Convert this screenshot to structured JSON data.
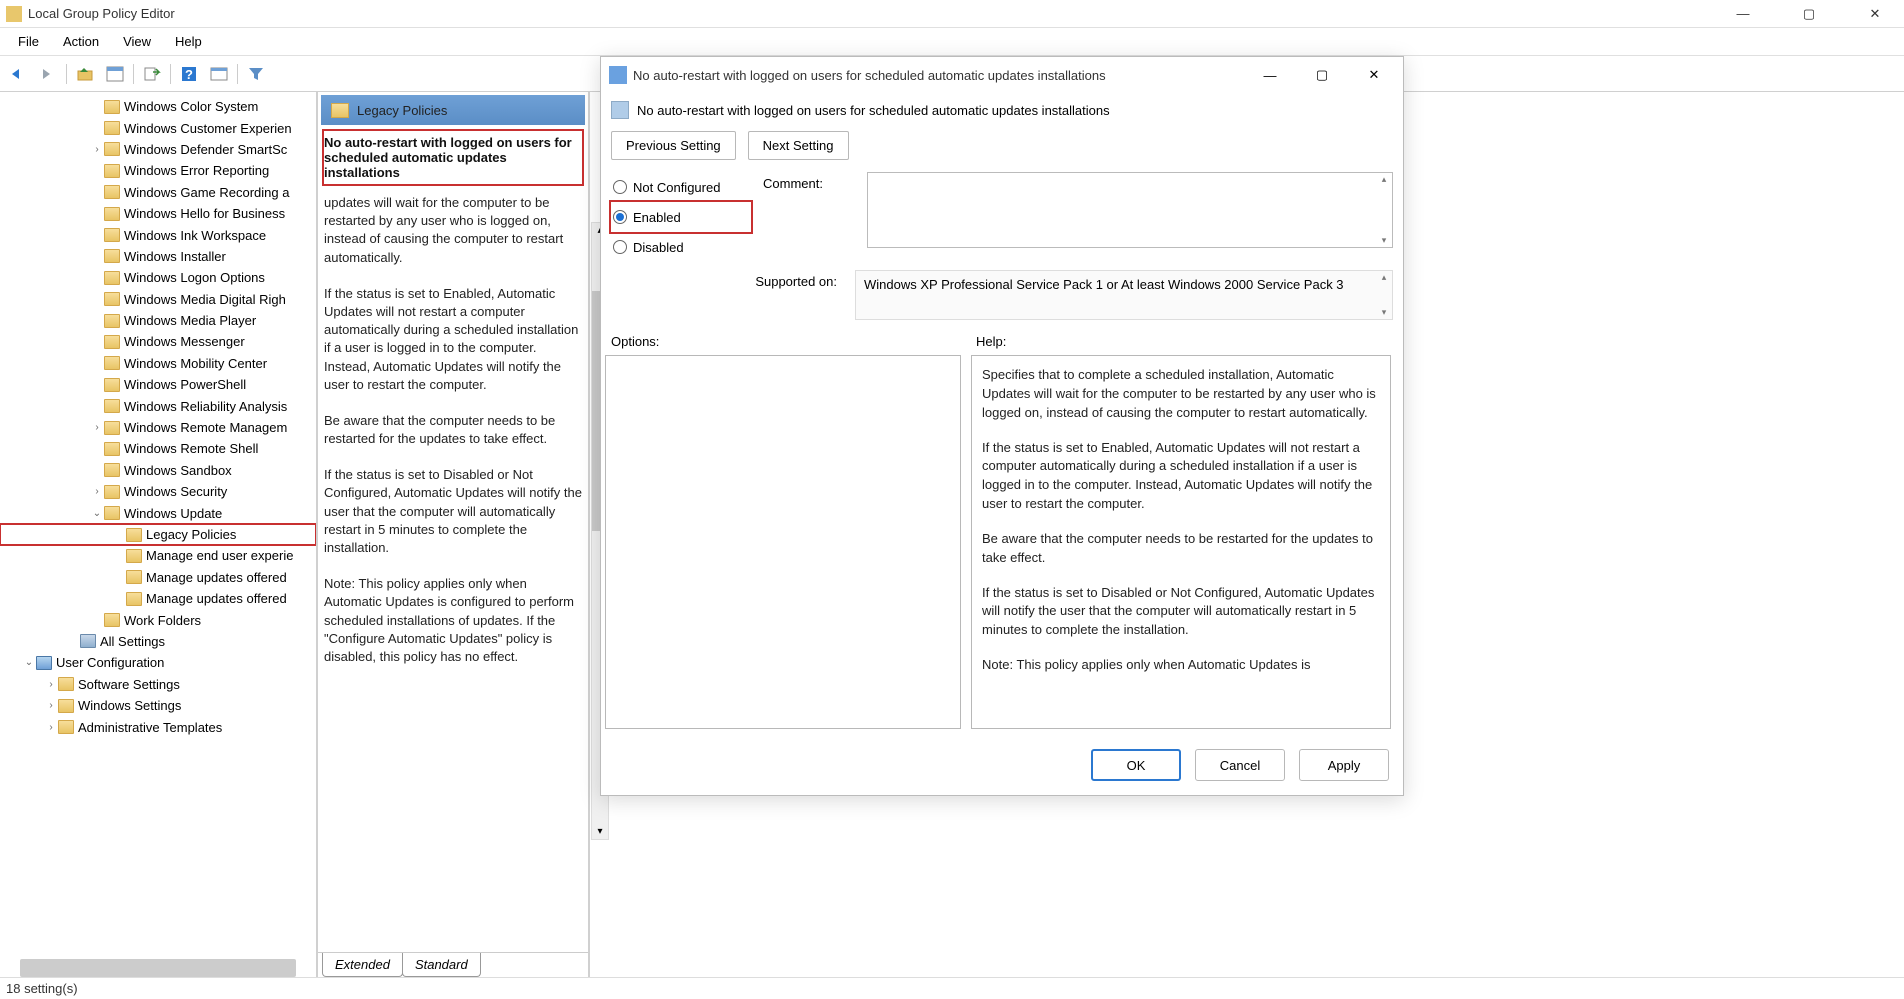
{
  "window": {
    "title": "Local Group Policy Editor",
    "menu": [
      "File",
      "Action",
      "View",
      "Help"
    ]
  },
  "tree": {
    "items": [
      {
        "d": "d1",
        "label": "Windows Color System"
      },
      {
        "d": "d1",
        "label": "Windows Customer Experien"
      },
      {
        "d": "d1",
        "label": "Windows Defender SmartSc",
        "exp": "›"
      },
      {
        "d": "d1",
        "label": "Windows Error Reporting"
      },
      {
        "d": "d1",
        "label": "Windows Game Recording a"
      },
      {
        "d": "d1",
        "label": "Windows Hello for Business"
      },
      {
        "d": "d1",
        "label": "Windows Ink Workspace"
      },
      {
        "d": "d1",
        "label": "Windows Installer"
      },
      {
        "d": "d1",
        "label": "Windows Logon Options"
      },
      {
        "d": "d1",
        "label": "Windows Media Digital Righ"
      },
      {
        "d": "d1",
        "label": "Windows Media Player"
      },
      {
        "d": "d1",
        "label": "Windows Messenger"
      },
      {
        "d": "d1",
        "label": "Windows Mobility Center"
      },
      {
        "d": "d1",
        "label": "Windows PowerShell"
      },
      {
        "d": "d1",
        "label": "Windows Reliability Analysis"
      },
      {
        "d": "d1",
        "label": "Windows Remote Managem",
        "exp": "›"
      },
      {
        "d": "d1",
        "label": "Windows Remote Shell"
      },
      {
        "d": "d1",
        "label": "Windows Sandbox"
      },
      {
        "d": "d1",
        "label": "Windows Security",
        "exp": "›"
      },
      {
        "d": "d1",
        "label": "Windows Update",
        "exp": "⌄"
      },
      {
        "d": "d2",
        "label": "Legacy Policies",
        "sel": true
      },
      {
        "d": "d2",
        "label": "Manage end user experie"
      },
      {
        "d": "d2",
        "label": "Manage updates offered"
      },
      {
        "d": "d2",
        "label": "Manage updates offered"
      },
      {
        "d": "d1",
        "label": "Work Folders"
      },
      {
        "d": "dm1b",
        "label": "All Settings",
        "ico": "cube"
      },
      {
        "d": "dm1",
        "label": "User Configuration",
        "exp": "⌄",
        "ico": "user"
      },
      {
        "d": "d0",
        "label": "Software Settings",
        "exp": "›"
      },
      {
        "d": "d0",
        "label": "Windows Settings",
        "exp": "›"
      },
      {
        "d": "d0",
        "label": "Administrative Templates",
        "exp": "›"
      }
    ]
  },
  "mid": {
    "header": "Legacy Policies",
    "title": "No auto-restart with logged on users for scheduled automatic updates installations",
    "p0": "updates will wait for the computer to be restarted by any user who is logged on, instead of causing the computer to restart automatically.",
    "p1": "If the status is set to Enabled, Automatic Updates will not restart a computer automatically during a scheduled installation if a user is logged in to the computer. Instead, Automatic Updates will notify the user to restart the computer.",
    "p2": "Be aware that the computer needs to be restarted for the updates to take effect.",
    "p3": "If the status is set to Disabled or Not Configured, Automatic Updates will notify the user that the computer will automatically restart in 5 minutes to complete the installation.",
    "p4": "Note: This policy applies only when Automatic Updates is configured to perform scheduled installations of updates. If the \"Configure Automatic Updates\" policy is disabled, this policy has no effect.",
    "tab_extended": "Extended",
    "tab_standard": "Standard"
  },
  "dialog": {
    "title": "No auto-restart with logged on users for scheduled automatic updates installations",
    "subtitle": "No auto-restart with logged on users for scheduled automatic updates installations",
    "prev": "Previous Setting",
    "next": "Next Setting",
    "radio": {
      "not_configured": "Not Configured",
      "enabled": "Enabled",
      "disabled": "Disabled",
      "selected": "enabled"
    },
    "comment_label": "Comment:",
    "supported_label": "Supported on:",
    "supported_text": "Windows XP Professional Service Pack 1 or At least Windows 2000 Service Pack 3",
    "options_label": "Options:",
    "help_label": "Help:",
    "help": {
      "p0": "Specifies that to complete a scheduled installation, Automatic Updates will wait for the computer to be restarted by any user who is logged on, instead of causing the computer to restart automatically.",
      "p1": "If the status is set to Enabled, Automatic Updates will not restart a computer automatically during a scheduled installation if a user is logged in to the computer. Instead, Automatic Updates will notify the user to restart the computer.",
      "p2": "Be aware that the computer needs to be restarted for the updates to take effect.",
      "p3": "If the status is set to Disabled or Not Configured, Automatic Updates will notify the user that the computer will automatically restart in 5 minutes to complete the installation.",
      "p4": "Note: This policy applies only when Automatic Updates is"
    },
    "buttons": {
      "ok": "OK",
      "cancel": "Cancel",
      "apply": "Apply"
    }
  },
  "status": "18 setting(s)"
}
